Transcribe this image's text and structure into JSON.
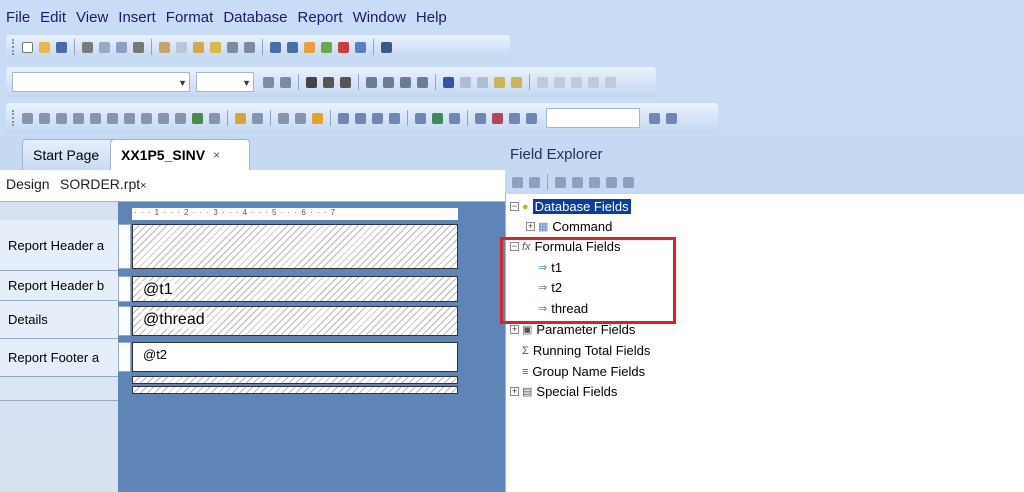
{
  "menu": [
    "File",
    "Edit",
    "View",
    "Insert",
    "Format",
    "Database",
    "Report",
    "Window",
    "Help"
  ],
  "tabs": {
    "start": "Start Page",
    "active": "XX1P5_SINV",
    "close": "×"
  },
  "subtabs": {
    "design": "Design",
    "file": "SORDER.rpt",
    "close": "×"
  },
  "ruler": "· · · 1 · · · 2 · · · 3 · · · 4 · · · 5 · · · 6 · · · 7",
  "sections": {
    "header_a": "Report Header a",
    "header_b": "Report Header b",
    "details": "Details",
    "footer_a": "Report Footer a"
  },
  "bands": {
    "header_b_field": "@t1",
    "details_field": "@thread",
    "footer_a_field": "@t2"
  },
  "field_explorer": {
    "title": "Field Explorer",
    "database_fields": "Database Fields",
    "command": "Command",
    "formula_fields": "Formula Fields",
    "formulas": [
      "t1",
      "t2",
      "thread"
    ],
    "parameter_fields": "Parameter Fields",
    "running_total_fields": "Running Total Fields",
    "group_name_fields": "Group Name Fields",
    "special_fields": "Special Fields"
  },
  "colors": {
    "highlight": "#d8232a",
    "selection": "#0a3d9c"
  }
}
